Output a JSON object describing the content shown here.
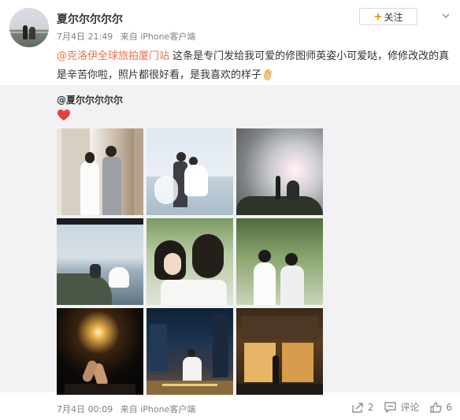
{
  "post": {
    "author": "夏尔尔尔尔尔",
    "time": "7月4日 21:49",
    "source": "来自 iPhone客户端",
    "follow_label": "关注",
    "mention": "@克洛伊全球旅拍厦门站",
    "text": " 这条是专门发给我可爱的修图师英姿小可爱哒，修修改改的真是辛苦你啦，照片都很好看，是我喜欢的样子"
  },
  "repost": {
    "author": "@夏尔尔尔尔尔",
    "photo_count": 9
  },
  "footer": {
    "time": "7月4日 00:09",
    "source": "来自 iPhone客户端",
    "repost_count": "2",
    "comment_label": "评论",
    "like_count": "6"
  },
  "icons": {
    "more": "chevron-down-icon",
    "share": "share-icon",
    "comment": "comment-icon",
    "like": "thumbs-up-icon",
    "heart": "red-heart-icon",
    "ok_hand": "ok-hand-emoji"
  },
  "colors": {
    "mention": "#eb7350",
    "follow_plus": "#ff8200",
    "heart": "#e8403a",
    "repost_bg": "#f2f2f5"
  }
}
